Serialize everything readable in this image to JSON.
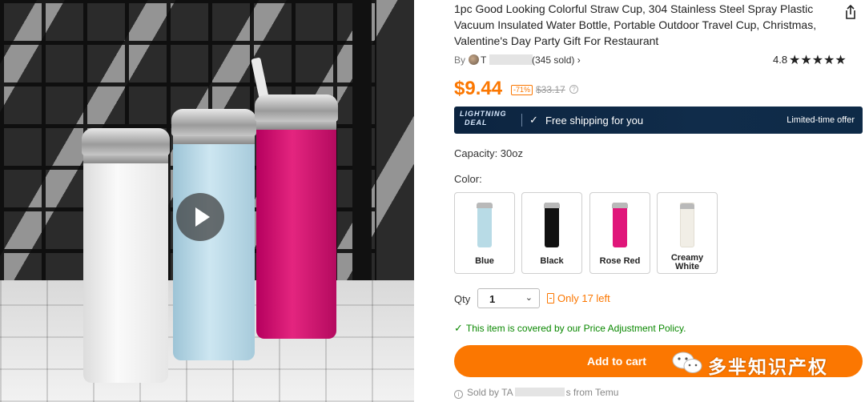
{
  "product": {
    "title": "1pc Good Looking Colorful Straw Cup, 304 Stainless Steel Spray Plastic Vacuum Insulated Water Bottle, Portable Outdoor Travel Cup, Christmas, Valentine's Day Party Gift For Restaurant"
  },
  "seller": {
    "by_label": "By",
    "name_visible": "T",
    "sold_text": "(345 sold) ›",
    "rating": "4.8",
    "stars": "★★★★★",
    "stars_value": 4.8
  },
  "price": {
    "current": "$9.44",
    "discount": "-71%",
    "original": "$33.17",
    "info_icon": "?"
  },
  "banner": {
    "line1": "LIGHTNING",
    "line2": "DEAL",
    "check": "✓",
    "shipping": "Free shipping for you",
    "offer": "Limited-time offer"
  },
  "capacity_text": "Capacity: 30oz",
  "color_label": "Color:",
  "colors": [
    {
      "label": "Blue",
      "swatch": "#b8dbe6"
    },
    {
      "label": "Black",
      "swatch": "#111111"
    },
    {
      "label": "Rose Red",
      "swatch": "#e0167a"
    },
    {
      "label_line1": "Creamy",
      "label_line2": "White",
      "swatch": "#f1eee6"
    }
  ],
  "qty": {
    "label": "Qty",
    "value": "1",
    "chevron": "⌄",
    "stock": "Only 17 left"
  },
  "policy": {
    "check": "✓",
    "text": "This item is covered by our Price Adjustment Policy."
  },
  "cart_button": "Add to cart",
  "watermark_text": "多芈知识产权",
  "sold_by": {
    "prefix": "Sold by TA",
    "suffix": "s from Temu",
    "icon": "i"
  },
  "colors_theme": {
    "accent": "#fb7701",
    "banner_bg": "#0c2440",
    "policy_green": "#0a8800"
  }
}
